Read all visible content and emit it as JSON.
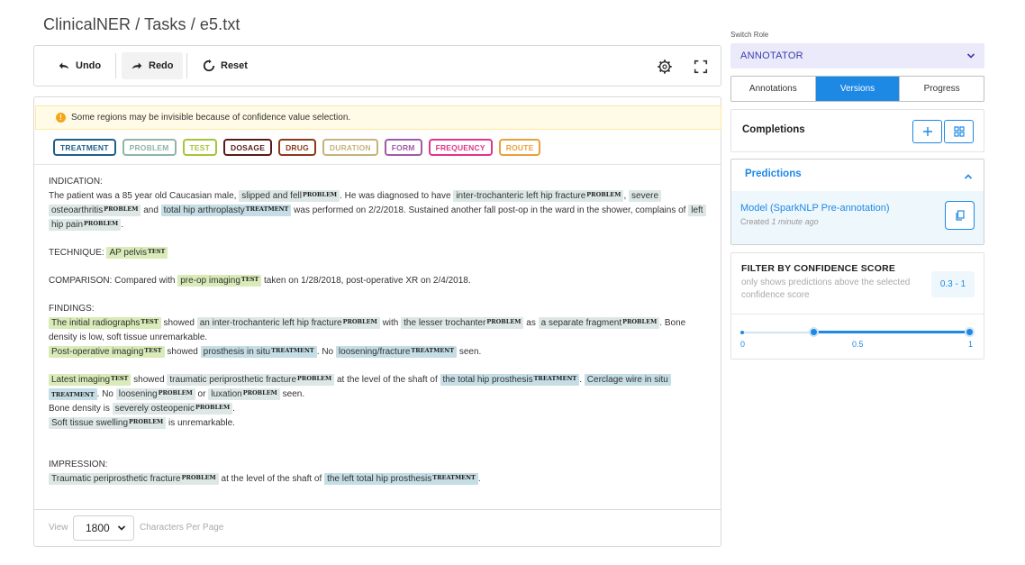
{
  "breadcrumb": "ClinicalNER / Tasks / e5.txt",
  "toolbar": {
    "undo_label": "Undo",
    "redo_label": "Redo",
    "reset_label": "Reset",
    "settings_icon": "gear-icon",
    "fullscreen_icon": "expand-icon"
  },
  "warning": "Some regions may be invisible because of confidence value selection.",
  "labels": [
    {
      "text": "TREATMENT",
      "color": "#1f5f8b"
    },
    {
      "text": "PROBLEM",
      "color": "#8fb5a9"
    },
    {
      "text": "TEST",
      "color": "#a5c43b"
    },
    {
      "text": "DOSAGE",
      "color": "#5a1a1a"
    },
    {
      "text": "DRUG",
      "color": "#8b3a1a"
    },
    {
      "text": "DURATION",
      "color": "#c6b37a"
    },
    {
      "text": "FORM",
      "color": "#a05aa8"
    },
    {
      "text": "FREQUENCY",
      "color": "#e0358a"
    },
    {
      "text": "ROUTE",
      "color": "#e8a23a"
    }
  ],
  "document": {
    "indication_heading": "INDICATION:",
    "s1": "The patient was a 85 year old Caucasian male,",
    "e1": "slipped and fell",
    "s2": ". He was diagnosed to have",
    "e2": "inter-trochanteric left hip fracture",
    "s3": ",",
    "e3a": "severe",
    "e3b": "osteoarthritis",
    "s4": "and",
    "e4": "total hip arthroplasty",
    "s5": "was performed on 2/2/2018. Sustained another fall post-op in the ward in the shower, complains of",
    "e5a": "left",
    "e5b": "hip pain",
    "s6": ".",
    "technique_heading": "TECHNIQUE:",
    "e6": "AP pelvis",
    "comparison_heading": "COMPARISON: Compared with",
    "e7": "pre-op imaging",
    "s7": "taken on 1/28/2018, post-operative XR on 2/4/2018.",
    "findings_heading": "FINDINGS:",
    "e8": "The initial radiographs",
    "s8": "showed",
    "e9": "an inter-trochanteric left hip fracture",
    "s9": "with",
    "e10": "the lesser trochanter",
    "s10": "as",
    "e11": "a separate fragment",
    "s11": ". Bone",
    "s12": "density is low, soft tissue unremarkable.",
    "e12": "Post-operative imaging",
    "s13": "showed",
    "e13": "prosthesis in situ",
    "s14": ". No",
    "e14": "loosening/fracture",
    "s15": "seen.",
    "e15": "Latest imaging",
    "s16": "showed",
    "e16": "traumatic periprosthetic fracture",
    "s17": "at the level of the shaft of",
    "e17": "the total hip prosthesis",
    "s18": ".",
    "e18a": "Cerclage wire in situ",
    "s19": ". No",
    "e19": "loosening",
    "s20": "or",
    "e20": "luxation",
    "s21": "seen.",
    "s22": "Bone density is",
    "e21": "severely osteopenic",
    "s23": ".",
    "e22": "Soft tissue swelling",
    "s24": "is unremarkable.",
    "impression_heading": "IMPRESSION:",
    "e23": "Traumatic periprosthetic fracture",
    "s25": "at the level of the shaft of",
    "e24": "the left total hip prosthesis",
    "s26": ".",
    "tag_problem": "PROBLEM",
    "tag_treatment": "TREATMENT",
    "tag_test": "TEST"
  },
  "pagination": {
    "view_label": "View",
    "value": "1800",
    "suffix": "Characters Per Page"
  },
  "sidebar": {
    "switch_role_label": "Switch Role",
    "role_value": "ANNOTATOR",
    "tabs": [
      "Annotations",
      "Versions",
      "Progress"
    ],
    "active_tab": "Versions",
    "completions_title": "Completions",
    "predictions_title": "Predictions",
    "model_name": "Model (SparkNLP Pre-annotation)",
    "model_created": "Created",
    "model_created_time": "1 minute ago",
    "filter_title": "FILTER BY CONFIDENCE SCORE",
    "filter_desc": "only shows predictions above the selected confidence score",
    "range_value": "0.3 - 1",
    "slider_ticks": [
      "0",
      "0.5",
      "1"
    ],
    "slider_low": 0.3,
    "slider_high": 1
  },
  "accent_color": "#1e88e5"
}
